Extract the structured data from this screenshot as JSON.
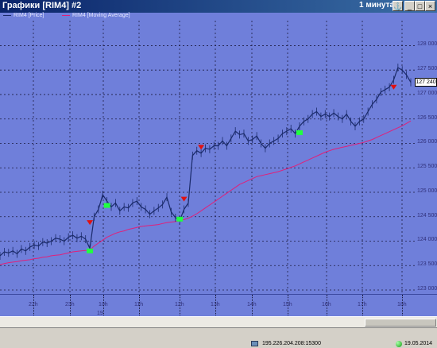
{
  "window": {
    "title": "Графики [RIM4] #2",
    "period": "1 минута",
    "buttons": {
      "anchor": "⚓",
      "minimize": "_",
      "maximize": "□",
      "close": "×"
    }
  },
  "legend": [
    {
      "label": "RIM4 [Price]",
      "color": "#1a2a6a"
    },
    {
      "label": "RIM4 [Moving Average]",
      "color": "#e0207a"
    }
  ],
  "axis": {
    "y_ticks": [
      "128 000",
      "127 500",
      "127 000",
      "126 500",
      "126 000",
      "125 500",
      "125 000",
      "124 500",
      "124 000",
      "123 500",
      "123 000"
    ],
    "current_price": "127 240",
    "x_ticks": [
      "22h",
      "23h",
      "10h",
      "11h",
      "12h",
      "13h",
      "14h",
      "15h",
      "16h",
      "17h",
      "18h"
    ],
    "date_marker": "19"
  },
  "chart_data": {
    "type": "line",
    "title": "",
    "xlabel": "",
    "ylabel": "",
    "ylim": [
      123000,
      128300
    ],
    "x_ticks": [
      "22h",
      "23h",
      "10h",
      "11h",
      "12h",
      "13h",
      "14h",
      "15h",
      "16h",
      "17h",
      "18h"
    ],
    "series": [
      {
        "name": "RIM4 [Price]",
        "color": "#1a2a6a",
        "values": [
          123700,
          123780,
          123760,
          123800,
          123740,
          123840,
          123800,
          123880,
          123920,
          123900,
          123980,
          123960,
          124000,
          124060,
          124040,
          124000,
          124080,
          124120,
          124060,
          124100,
          124040,
          123850,
          124500,
          124650,
          124950,
          124820,
          124700,
          124780,
          124620,
          124700,
          124680,
          124780,
          124820,
          124700,
          124650,
          124550,
          124620,
          124680,
          124750,
          124900,
          124600,
          124480,
          124420,
          124650,
          124780,
          125750,
          125850,
          125800,
          125900,
          125880,
          125950,
          125950,
          126050,
          125950,
          126100,
          126250,
          126180,
          126200,
          126050,
          126080,
          126150,
          126000,
          125900,
          126000,
          126050,
          126100,
          126200,
          126250,
          126300,
          126200,
          126350,
          126450,
          126500,
          126600,
          126650,
          126550,
          126600,
          126550,
          126620,
          126550,
          126500,
          126600,
          126450,
          126350,
          126450,
          126500,
          126650,
          126800,
          126900,
          127050,
          127100,
          127150,
          127300,
          127550,
          127500,
          127400,
          127250
        ]
      },
      {
        "name": "RIM4 [Moving Average]",
        "color": "#e0207a",
        "values": [
          123520,
          123540,
          123560,
          123570,
          123580,
          123600,
          123610,
          123620,
          123640,
          123650,
          123670,
          123680,
          123700,
          123710,
          123720,
          123740,
          123760,
          123780,
          123790,
          123800,
          123810,
          123820,
          123900,
          123960,
          124020,
          124080,
          124120,
          124160,
          124190,
          124210,
          124240,
          124260,
          124280,
          124300,
          124310,
          124320,
          124330,
          124340,
          124360,
          124380,
          124390,
          124400,
          124420,
          124440,
          124470,
          124510,
          124560,
          124620,
          124680,
          124740,
          124800,
          124860,
          124920,
          124980,
          125040,
          125100,
          125160,
          125200,
          125240,
          125280,
          125320,
          125340,
          125360,
          125380,
          125400,
          125420,
          125450,
          125480,
          125510,
          125540,
          125580,
          125620,
          125660,
          125700,
          125740,
          125780,
          125820,
          125850,
          125880,
          125900,
          125920,
          125940,
          125960,
          125980,
          126000,
          126020,
          126050,
          126080,
          126120,
          126160,
          126200,
          126240,
          126280,
          126320,
          126360,
          126410,
          126460
        ]
      }
    ],
    "signals": [
      {
        "index": 21,
        "value": 124380,
        "kind": "sell",
        "color": "#e01010"
      },
      {
        "index": 21,
        "value": 123800,
        "kind": "buy",
        "color": "#20ff40"
      },
      {
        "index": 25,
        "value": 124730,
        "kind": "buy",
        "color": "#20ff40"
      },
      {
        "index": 43,
        "value": 124860,
        "kind": "sell",
        "color": "#e01010"
      },
      {
        "index": 42,
        "value": 124450,
        "kind": "buy",
        "color": "#20ff40"
      },
      {
        "index": 47,
        "value": 125920,
        "kind": "sell",
        "color": "#e01010"
      },
      {
        "index": 70,
        "value": 126220,
        "kind": "buy",
        "color": "#20ff40"
      },
      {
        "index": 92,
        "value": 127150,
        "kind": "sell",
        "color": "#e01010"
      }
    ],
    "grid": true,
    "legend_position": "top-left"
  },
  "status": {
    "server": "195.226.204.208:15300",
    "date": "19.05.2014"
  },
  "colors": {
    "background": "#6f7fda",
    "grid": "#1c1c40",
    "axis_text": "#30307a"
  }
}
